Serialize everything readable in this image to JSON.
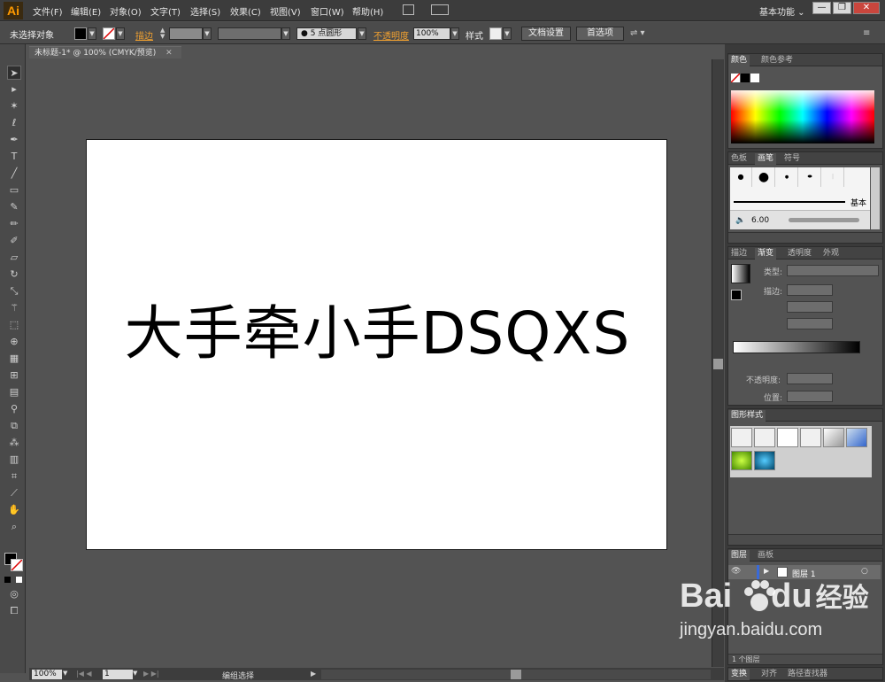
{
  "app": {
    "logo": "Ai",
    "workspace": "基本功能 ⌄"
  },
  "menu": [
    "文件(F)",
    "编辑(E)",
    "对象(O)",
    "文字(T)",
    "选择(S)",
    "效果(C)",
    "视图(V)",
    "窗口(W)",
    "帮助(H)"
  ],
  "window_controls": {
    "minimize": "—",
    "restore": "❐",
    "close": "✕"
  },
  "control_bar": {
    "selection_status": "未选择对象",
    "stroke_label": "描边",
    "brush_value": "5 点圆形",
    "opacity_label": "不透明度",
    "opacity_value": "100%",
    "style_label": "样式",
    "doc_setup": "文档设置",
    "prefs": "首选项"
  },
  "document": {
    "tab_title": "未标题-1* @ 100% (CMYK/预览)",
    "tab_close": "✕",
    "canvas_text": "大手牵小手DSQXS"
  },
  "status": {
    "zoom": "100%",
    "artboard": "1",
    "tool_status": "编组选择"
  },
  "panels": {
    "color": {
      "tabs": [
        "颜色",
        "颜色参考"
      ]
    },
    "brush": {
      "tabs": [
        "色板",
        "画笔",
        "符号"
      ],
      "basic_label": "基本",
      "size_label": "6.00"
    },
    "gradient": {
      "tabs": [
        "描边",
        "渐变",
        "透明度",
        "外观"
      ],
      "type_label": "类型:",
      "stroke_label": "描边:",
      "opacity_label": "不透明度:",
      "position_label": "位置:"
    },
    "graphic_styles": {
      "tabs": [
        "图形样式"
      ]
    },
    "layers": {
      "tabs": [
        "图层",
        "画板"
      ],
      "layer_name": "图层 1",
      "footer": "1 个图层"
    },
    "bottom": {
      "tabs": [
        "变换",
        "对齐",
        "路径查找器"
      ]
    }
  },
  "watermark": {
    "brand_a": "Bai",
    "brand_b": "du",
    "brand_cn": "经验",
    "url": "jingyan.baidu.com"
  },
  "colors": {
    "accent": "#ff9a00",
    "artboard": "#ffffff",
    "workspace": "#535353"
  }
}
